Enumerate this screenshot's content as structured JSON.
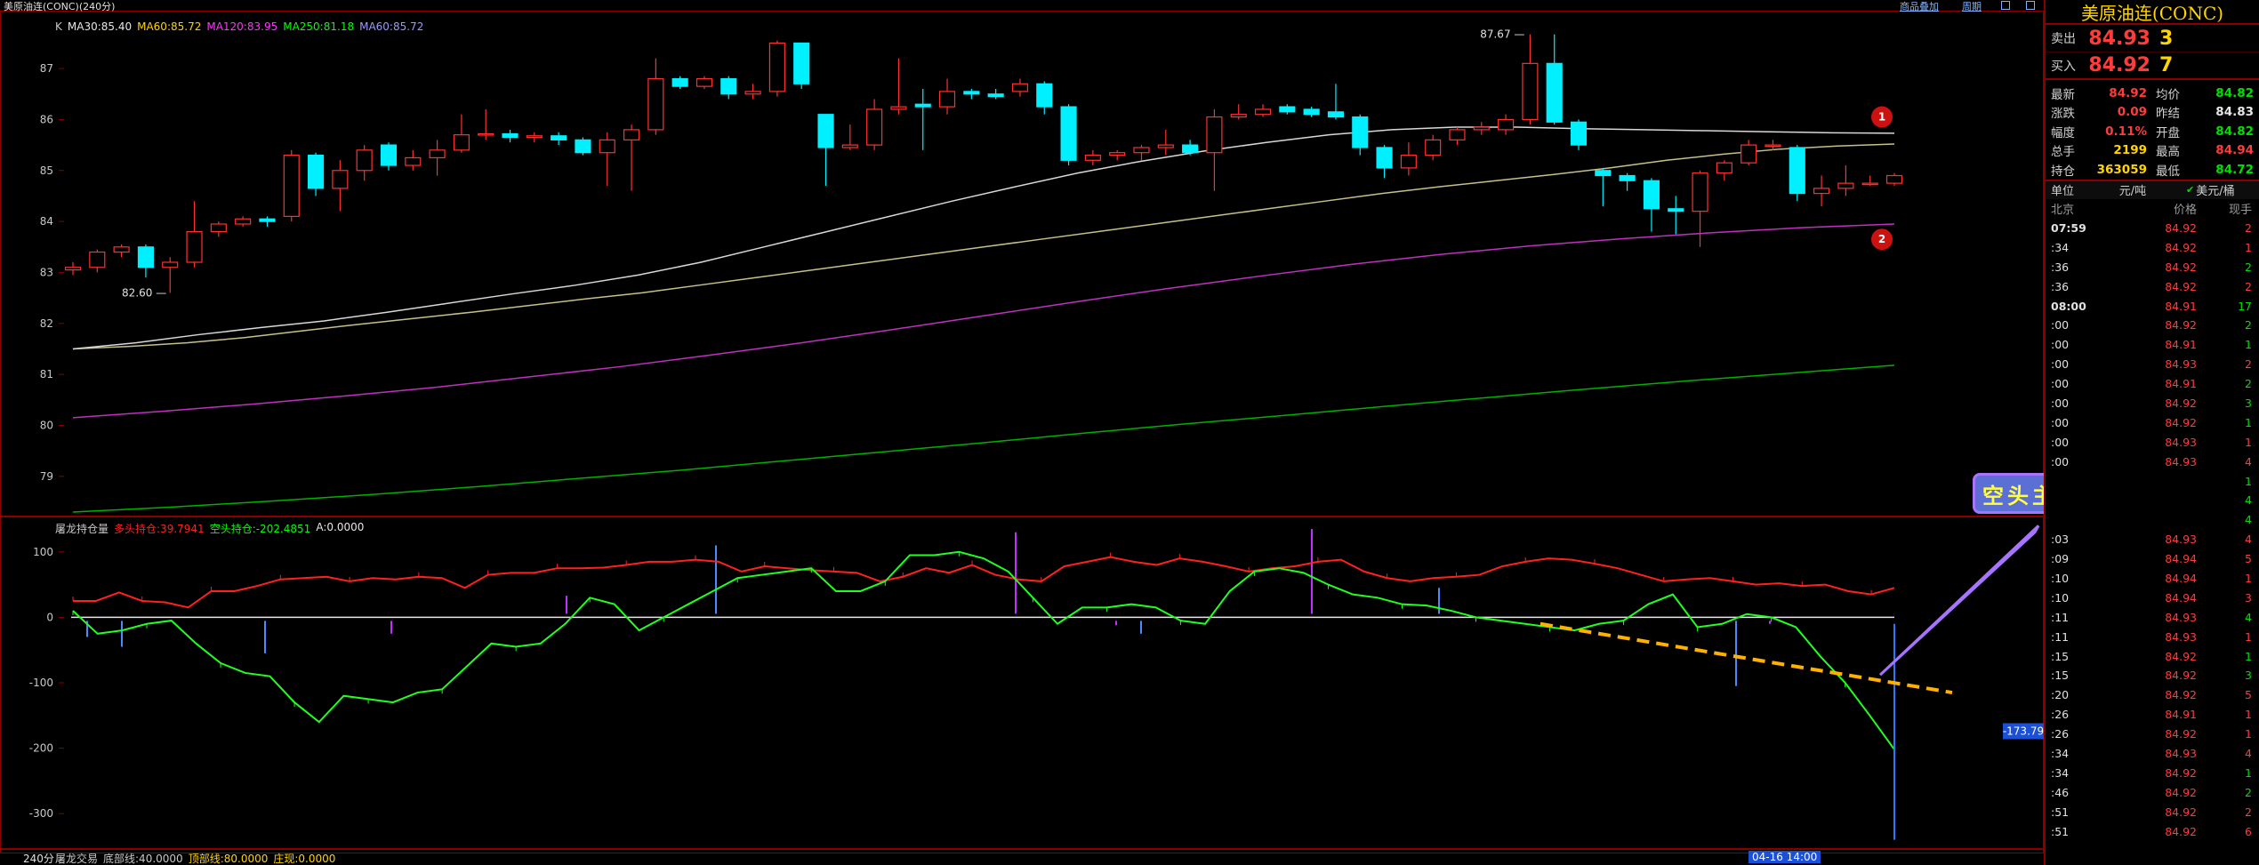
{
  "window": {
    "title": "美原油连(CONC)(240分)",
    "links": [
      "商品叠加",
      "周期"
    ],
    "period_label": "240分",
    "time_label": "04-16 14:00"
  },
  "main": {
    "legend": [
      {
        "text": "K",
        "color": "#c8c8c8"
      },
      {
        "text": "MA30:85.40",
        "color": "#e6e6e6"
      },
      {
        "text": "MA60:85.72",
        "color": "#ffd400"
      },
      {
        "text": "MA120:83.95",
        "color": "#ff33ff"
      },
      {
        "text": "MA250:81.18",
        "color": "#00ff00"
      },
      {
        "text": "MA60:85.72",
        "color": "#9a9aff"
      }
    ],
    "y_ticks": [
      "87",
      "86",
      "85",
      "84",
      "83",
      "82",
      "81",
      "80",
      "79"
    ],
    "high_label": "87.67",
    "low_label": "82.60",
    "marker_1": "1",
    "marker_2": "2"
  },
  "indicator": {
    "legend": [
      {
        "text": "屠龙持仓量",
        "color": "#c8c8c8"
      },
      {
        "text": "多头持仓:39.7941",
        "color": "#ff2020"
      },
      {
        "text": "空头持仓:-202.4851",
        "color": "#00ff00"
      },
      {
        "text": "A:0.0000",
        "color": "#e6e6e6"
      }
    ],
    "y_ticks": [
      "100",
      "0",
      "-100",
      "-200",
      "-300"
    ],
    "current_value": "-173.79",
    "annotation": "空头主力大量出逃"
  },
  "bottom": {
    "legend": [
      {
        "text": "屠龙交易",
        "color": "#c8c8c8"
      },
      {
        "text": "底部线:40.0000",
        "color": "#c8c8c8"
      },
      {
        "text": "顶部线:80.0000",
        "color": "#ffd400"
      },
      {
        "text": "庄现:0.0000",
        "color": "#ffd400"
      }
    ]
  },
  "side": {
    "title": "美原油连(CONC)",
    "ask": {
      "label": "卖出",
      "price": "84.93",
      "vol": "3"
    },
    "bid": {
      "label": "买入",
      "price": "84.92",
      "vol": "7"
    },
    "stats": [
      {
        "l": "最新",
        "v": "84.92",
        "vc": "#ff3b3b",
        "l2": "均价",
        "v2": "84.82",
        "v2c": "#00e000"
      },
      {
        "l": "涨跌",
        "v": "0.09",
        "vc": "#ff3b3b",
        "l2": "昨结",
        "v2": "84.83",
        "v2c": "#e6e6e6"
      },
      {
        "l": "幅度",
        "v": "0.11%",
        "vc": "#ff3b3b",
        "l2": "开盘",
        "v2": "84.82",
        "v2c": "#00e000"
      },
      {
        "l": "总手",
        "v": "2199",
        "vc": "#ffd400",
        "l2": "最高",
        "v2": "84.94",
        "v2c": "#ff3b3b"
      },
      {
        "l": "持仓",
        "v": "363059",
        "vc": "#ffd400",
        "l2": "最低",
        "v2": "84.72",
        "v2c": "#00e000"
      }
    ],
    "unit_label": "单位",
    "unit_a": "元/吨",
    "unit_b": "美元/桶",
    "col_headers": [
      "北京",
      "价格",
      "现手"
    ],
    "ticks": [
      {
        "t": "07:59",
        "p": "84.92",
        "v": "2",
        "vc": "#ff3b3b"
      },
      {
        "t": ":34",
        "p": "84.92",
        "v": "1",
        "vc": "#ff3b3b"
      },
      {
        "t": ":36",
        "p": "84.92",
        "v": "2",
        "vc": "#00e000"
      },
      {
        "t": ":36",
        "p": "84.92",
        "v": "2",
        "vc": "#ff3b3b"
      },
      {
        "t": "08:00",
        "p": "84.91",
        "v": "17",
        "vc": "#00e000"
      },
      {
        "t": ":00",
        "p": "84.92",
        "v": "2",
        "vc": "#00e000"
      },
      {
        "t": ":00",
        "p": "84.91",
        "v": "1",
        "vc": "#00e000"
      },
      {
        "t": ":00",
        "p": "84.93",
        "v": "2",
        "vc": "#ff3b3b"
      },
      {
        "t": ":00",
        "p": "84.91",
        "v": "2",
        "vc": "#00e000"
      },
      {
        "t": ":00",
        "p": "84.92",
        "v": "3",
        "vc": "#00e000"
      },
      {
        "t": ":00",
        "p": "84.92",
        "v": "1",
        "vc": "#00e000"
      },
      {
        "t": ":00",
        "p": "84.93",
        "v": "1",
        "vc": "#ff3b3b"
      },
      {
        "t": ":00",
        "p": "84.93",
        "v": "4",
        "vc": "#ff3b3b"
      },
      {
        "t": "",
        "p": "",
        "v": "1",
        "vc": "#00e000"
      },
      {
        "t": "",
        "p": "",
        "v": "4",
        "vc": "#00e000"
      },
      {
        "t": "",
        "p": "",
        "v": "4",
        "vc": "#00e000"
      },
      {
        "t": ":03",
        "p": "84.93",
        "v": "4",
        "vc": "#ff3b3b"
      },
      {
        "t": ":09",
        "p": "84.94",
        "v": "5",
        "vc": "#ff3b3b"
      },
      {
        "t": ":10",
        "p": "84.94",
        "v": "1",
        "vc": "#ff3b3b"
      },
      {
        "t": ":10",
        "p": "84.94",
        "v": "3",
        "vc": "#ff3b3b"
      },
      {
        "t": ":11",
        "p": "84.93",
        "v": "4",
        "vc": "#00e000"
      },
      {
        "t": ":11",
        "p": "84.93",
        "v": "1",
        "vc": "#ff3b3b"
      },
      {
        "t": ":15",
        "p": "84.92",
        "v": "1",
        "vc": "#00e000"
      },
      {
        "t": ":15",
        "p": "84.92",
        "v": "3",
        "vc": "#00e000"
      },
      {
        "t": ":20",
        "p": "84.92",
        "v": "5",
        "vc": "#ff3b3b"
      },
      {
        "t": ":26",
        "p": "84.91",
        "v": "1",
        "vc": "#ff3b3b"
      },
      {
        "t": ":26",
        "p": "84.92",
        "v": "1",
        "vc": "#ff3b3b"
      },
      {
        "t": ":34",
        "p": "84.93",
        "v": "4",
        "vc": "#ff3b3b"
      },
      {
        "t": ":34",
        "p": "84.92",
        "v": "1",
        "vc": "#00e000"
      },
      {
        "t": ":46",
        "p": "84.92",
        "v": "2",
        "vc": "#00e000"
      },
      {
        "t": ":51",
        "p": "84.92",
        "v": "2",
        "vc": "#ff3b3b"
      },
      {
        "t": ":51",
        "p": "84.92",
        "v": "6",
        "vc": "#ff3b3b"
      }
    ]
  },
  "chart_data": {
    "type": "candlestick",
    "y_range": [
      78.3,
      88.1
    ],
    "candles": [
      {
        "o": 83.05,
        "c": 83.1,
        "h": 83.2,
        "l": 82.95
      },
      {
        "o": 83.1,
        "c": 83.4,
        "h": 83.45,
        "l": 83.0
      },
      {
        "o": 83.4,
        "c": 83.5,
        "h": 83.55,
        "l": 83.3
      },
      {
        "o": 83.5,
        "c": 83.1,
        "h": 83.55,
        "l": 82.9
      },
      {
        "o": 83.1,
        "c": 83.2,
        "h": 83.3,
        "l": 82.6
      },
      {
        "o": 83.2,
        "c": 83.8,
        "h": 84.4,
        "l": 83.1
      },
      {
        "o": 83.8,
        "c": 83.95,
        "h": 84.0,
        "l": 83.7
      },
      {
        "o": 83.95,
        "c": 84.05,
        "h": 84.1,
        "l": 83.9
      },
      {
        "o": 84.05,
        "c": 84.0,
        "h": 84.1,
        "l": 83.9
      },
      {
        "o": 84.1,
        "c": 85.3,
        "h": 85.4,
        "l": 84.0
      },
      {
        "o": 85.3,
        "c": 84.65,
        "h": 85.35,
        "l": 84.5
      },
      {
        "o": 84.65,
        "c": 85.0,
        "h": 85.2,
        "l": 84.2
      },
      {
        "o": 85.0,
        "c": 85.4,
        "h": 85.5,
        "l": 84.8
      },
      {
        "o": 85.5,
        "c": 85.1,
        "h": 85.55,
        "l": 85.0
      },
      {
        "o": 85.1,
        "c": 85.25,
        "h": 85.4,
        "l": 85.0
      },
      {
        "o": 85.25,
        "c": 85.4,
        "h": 85.6,
        "l": 84.9
      },
      {
        "o": 85.4,
        "c": 85.7,
        "h": 86.1,
        "l": 85.35
      },
      {
        "o": 85.7,
        "c": 85.72,
        "h": 86.2,
        "l": 85.6
      },
      {
        "o": 85.72,
        "c": 85.65,
        "h": 85.8,
        "l": 85.55
      },
      {
        "o": 85.65,
        "c": 85.68,
        "h": 85.75,
        "l": 85.55
      },
      {
        "o": 85.68,
        "c": 85.6,
        "h": 85.75,
        "l": 85.5
      },
      {
        "o": 85.6,
        "c": 85.35,
        "h": 85.65,
        "l": 85.3
      },
      {
        "o": 85.35,
        "c": 85.6,
        "h": 85.75,
        "l": 84.7
      },
      {
        "o": 85.6,
        "c": 85.8,
        "h": 85.9,
        "l": 84.6
      },
      {
        "o": 85.8,
        "c": 86.8,
        "h": 87.2,
        "l": 85.7
      },
      {
        "o": 86.8,
        "c": 86.65,
        "h": 86.85,
        "l": 86.6
      },
      {
        "o": 86.65,
        "c": 86.8,
        "h": 86.85,
        "l": 86.6
      },
      {
        "o": 86.8,
        "c": 86.5,
        "h": 86.85,
        "l": 86.4
      },
      {
        "o": 86.5,
        "c": 86.55,
        "h": 86.7,
        "l": 86.4
      },
      {
        "o": 86.55,
        "c": 87.5,
        "h": 87.55,
        "l": 86.45
      },
      {
        "o": 87.5,
        "c": 86.7,
        "h": 87.5,
        "l": 86.6
      },
      {
        "o": 86.1,
        "c": 85.45,
        "h": 86.1,
        "l": 84.7
      },
      {
        "o": 85.45,
        "c": 85.5,
        "h": 85.9,
        "l": 85.4
      },
      {
        "o": 85.5,
        "c": 86.2,
        "h": 86.4,
        "l": 85.4
      },
      {
        "o": 86.2,
        "c": 86.25,
        "h": 87.2,
        "l": 86.1
      },
      {
        "o": 86.3,
        "c": 86.25,
        "h": 86.6,
        "l": 85.4
      },
      {
        "o": 86.25,
        "c": 86.55,
        "h": 86.8,
        "l": 86.1
      },
      {
        "o": 86.55,
        "c": 86.5,
        "h": 86.6,
        "l": 86.4
      },
      {
        "o": 86.5,
        "c": 86.45,
        "h": 86.6,
        "l": 86.4
      },
      {
        "o": 86.55,
        "c": 86.7,
        "h": 86.8,
        "l": 86.45
      },
      {
        "o": 86.7,
        "c": 86.25,
        "h": 86.75,
        "l": 86.1
      },
      {
        "o": 86.25,
        "c": 85.2,
        "h": 86.3,
        "l": 85.1
      },
      {
        "o": 85.2,
        "c": 85.3,
        "h": 85.4,
        "l": 85.1
      },
      {
        "o": 85.3,
        "c": 85.35,
        "h": 85.4,
        "l": 85.2
      },
      {
        "o": 85.35,
        "c": 85.45,
        "h": 85.5,
        "l": 85.2
      },
      {
        "o": 85.45,
        "c": 85.5,
        "h": 85.8,
        "l": 85.3
      },
      {
        "o": 85.5,
        "c": 85.35,
        "h": 85.6,
        "l": 85.3
      },
      {
        "o": 85.35,
        "c": 86.05,
        "h": 86.2,
        "l": 84.6
      },
      {
        "o": 86.05,
        "c": 86.1,
        "h": 86.3,
        "l": 86.0
      },
      {
        "o": 86.1,
        "c": 86.2,
        "h": 86.3,
        "l": 86.05
      },
      {
        "o": 86.25,
        "c": 86.15,
        "h": 86.3,
        "l": 86.1
      },
      {
        "o": 86.2,
        "c": 86.1,
        "h": 86.25,
        "l": 86.05
      },
      {
        "o": 86.15,
        "c": 86.05,
        "h": 86.7,
        "l": 86.0
      },
      {
        "o": 86.05,
        "c": 85.45,
        "h": 86.1,
        "l": 85.3
      },
      {
        "o": 85.45,
        "c": 85.05,
        "h": 85.5,
        "l": 84.85
      },
      {
        "o": 85.05,
        "c": 85.3,
        "h": 85.55,
        "l": 84.9
      },
      {
        "o": 85.3,
        "c": 85.6,
        "h": 85.7,
        "l": 85.2
      },
      {
        "o": 85.6,
        "c": 85.8,
        "h": 85.85,
        "l": 85.5
      },
      {
        "o": 85.8,
        "c": 85.85,
        "h": 85.95,
        "l": 85.7
      },
      {
        "o": 85.8,
        "c": 86.0,
        "h": 86.1,
        "l": 85.7
      },
      {
        "o": 86.0,
        "c": 87.1,
        "h": 87.67,
        "l": 85.9
      },
      {
        "o": 87.1,
        "c": 85.95,
        "h": 87.67,
        "l": 85.9
      },
      {
        "o": 85.95,
        "c": 85.5,
        "h": 86.0,
        "l": 85.4
      },
      {
        "o": 85.0,
        "c": 84.9,
        "h": 85.05,
        "l": 84.3
      },
      {
        "o": 84.9,
        "c": 84.8,
        "h": 84.95,
        "l": 84.6
      },
      {
        "o": 84.8,
        "c": 84.25,
        "h": 84.85,
        "l": 83.8
      },
      {
        "o": 84.25,
        "c": 84.2,
        "h": 84.5,
        "l": 83.75
      },
      {
        "o": 84.2,
        "c": 84.95,
        "h": 85.0,
        "l": 83.5
      },
      {
        "o": 84.95,
        "c": 85.15,
        "h": 85.2,
        "l": 84.8
      },
      {
        "o": 85.15,
        "c": 85.5,
        "h": 85.6,
        "l": 85.1
      },
      {
        "o": 85.5,
        "c": 85.5,
        "h": 85.6,
        "l": 85.4
      },
      {
        "o": 85.45,
        "c": 84.55,
        "h": 85.5,
        "l": 84.4
      },
      {
        "o": 84.55,
        "c": 84.65,
        "h": 84.9,
        "l": 84.3
      },
      {
        "o": 84.65,
        "c": 84.75,
        "h": 85.1,
        "l": 84.5
      },
      {
        "o": 84.75,
        "c": 84.75,
        "h": 84.9,
        "l": 84.7
      },
      {
        "o": 84.75,
        "c": 84.9,
        "h": 84.95,
        "l": 84.7
      }
    ],
    "ma30": [
      81.5,
      81.62,
      81.78,
      81.92,
      82.05,
      82.22,
      82.4,
      82.58,
      82.75,
      82.95,
      83.2,
      83.5,
      83.8,
      84.1,
      84.4,
      84.68,
      84.95,
      85.18,
      85.38,
      85.55,
      85.7,
      85.8,
      85.85,
      85.85,
      85.82,
      85.8,
      85.78,
      85.76,
      85.74,
      85.73
    ],
    "ma60": [
      81.5,
      81.55,
      81.62,
      81.72,
      81.85,
      81.98,
      82.1,
      82.22,
      82.35,
      82.48,
      82.6,
      82.75,
      82.9,
      83.05,
      83.2,
      83.35,
      83.5,
      83.65,
      83.8,
      83.95,
      84.1,
      84.25,
      84.4,
      84.55,
      84.68,
      84.8,
      84.92,
      85.05,
      85.2,
      85.32,
      85.42,
      85.48,
      85.52
    ],
    "ma120": [
      80.15,
      80.28,
      80.42,
      80.58,
      80.75,
      80.95,
      81.15,
      81.38,
      81.62,
      81.88,
      82.15,
      82.42,
      82.68,
      82.92,
      83.15,
      83.35,
      83.52,
      83.66,
      83.78,
      83.88,
      83.95
    ],
    "ma250": [
      78.3,
      78.4,
      78.52,
      78.65,
      78.8,
      78.96,
      79.12,
      79.3,
      79.48,
      79.66,
      79.85,
      80.03,
      80.2,
      80.38,
      80.55,
      80.72,
      80.88,
      81.03,
      81.18
    ],
    "long_position": [
      25,
      25,
      38,
      25,
      23,
      15,
      40,
      40,
      48,
      58,
      60,
      62,
      55,
      60,
      58,
      62,
      60,
      45,
      65,
      68,
      68,
      75,
      75,
      76,
      80,
      85,
      85,
      88,
      85,
      70,
      78,
      75,
      72,
      70,
      68,
      55,
      62,
      75,
      68,
      80,
      65,
      58,
      55,
      78,
      85,
      92,
      85,
      80,
      90,
      85,
      78,
      70,
      75,
      78,
      85,
      88,
      70,
      60,
      55,
      60,
      62,
      65,
      78,
      85,
      90,
      88,
      82,
      75,
      65,
      55,
      58,
      60,
      55,
      50,
      52,
      48,
      50,
      40,
      35,
      45
    ],
    "short_position": [
      10,
      -25,
      -20,
      -10,
      -5,
      -40,
      -70,
      -85,
      -90,
      -130,
      -160,
      -120,
      -125,
      -130,
      -115,
      -110,
      -75,
      -40,
      -45,
      -40,
      -10,
      30,
      20,
      -20,
      0,
      20,
      40,
      60,
      65,
      70,
      75,
      40,
      40,
      55,
      95,
      95,
      100,
      90,
      70,
      30,
      -10,
      15,
      15,
      20,
      15,
      -5,
      -10,
      40,
      70,
      75,
      68,
      50,
      35,
      30,
      20,
      18,
      10,
      0,
      -5,
      -10,
      -15,
      -20,
      -10,
      -5,
      20,
      35,
      -15,
      -10,
      5,
      0,
      -15,
      -60,
      -100,
      -150,
      -202
    ],
    "indicator_range": [
      -350,
      150
    ]
  }
}
